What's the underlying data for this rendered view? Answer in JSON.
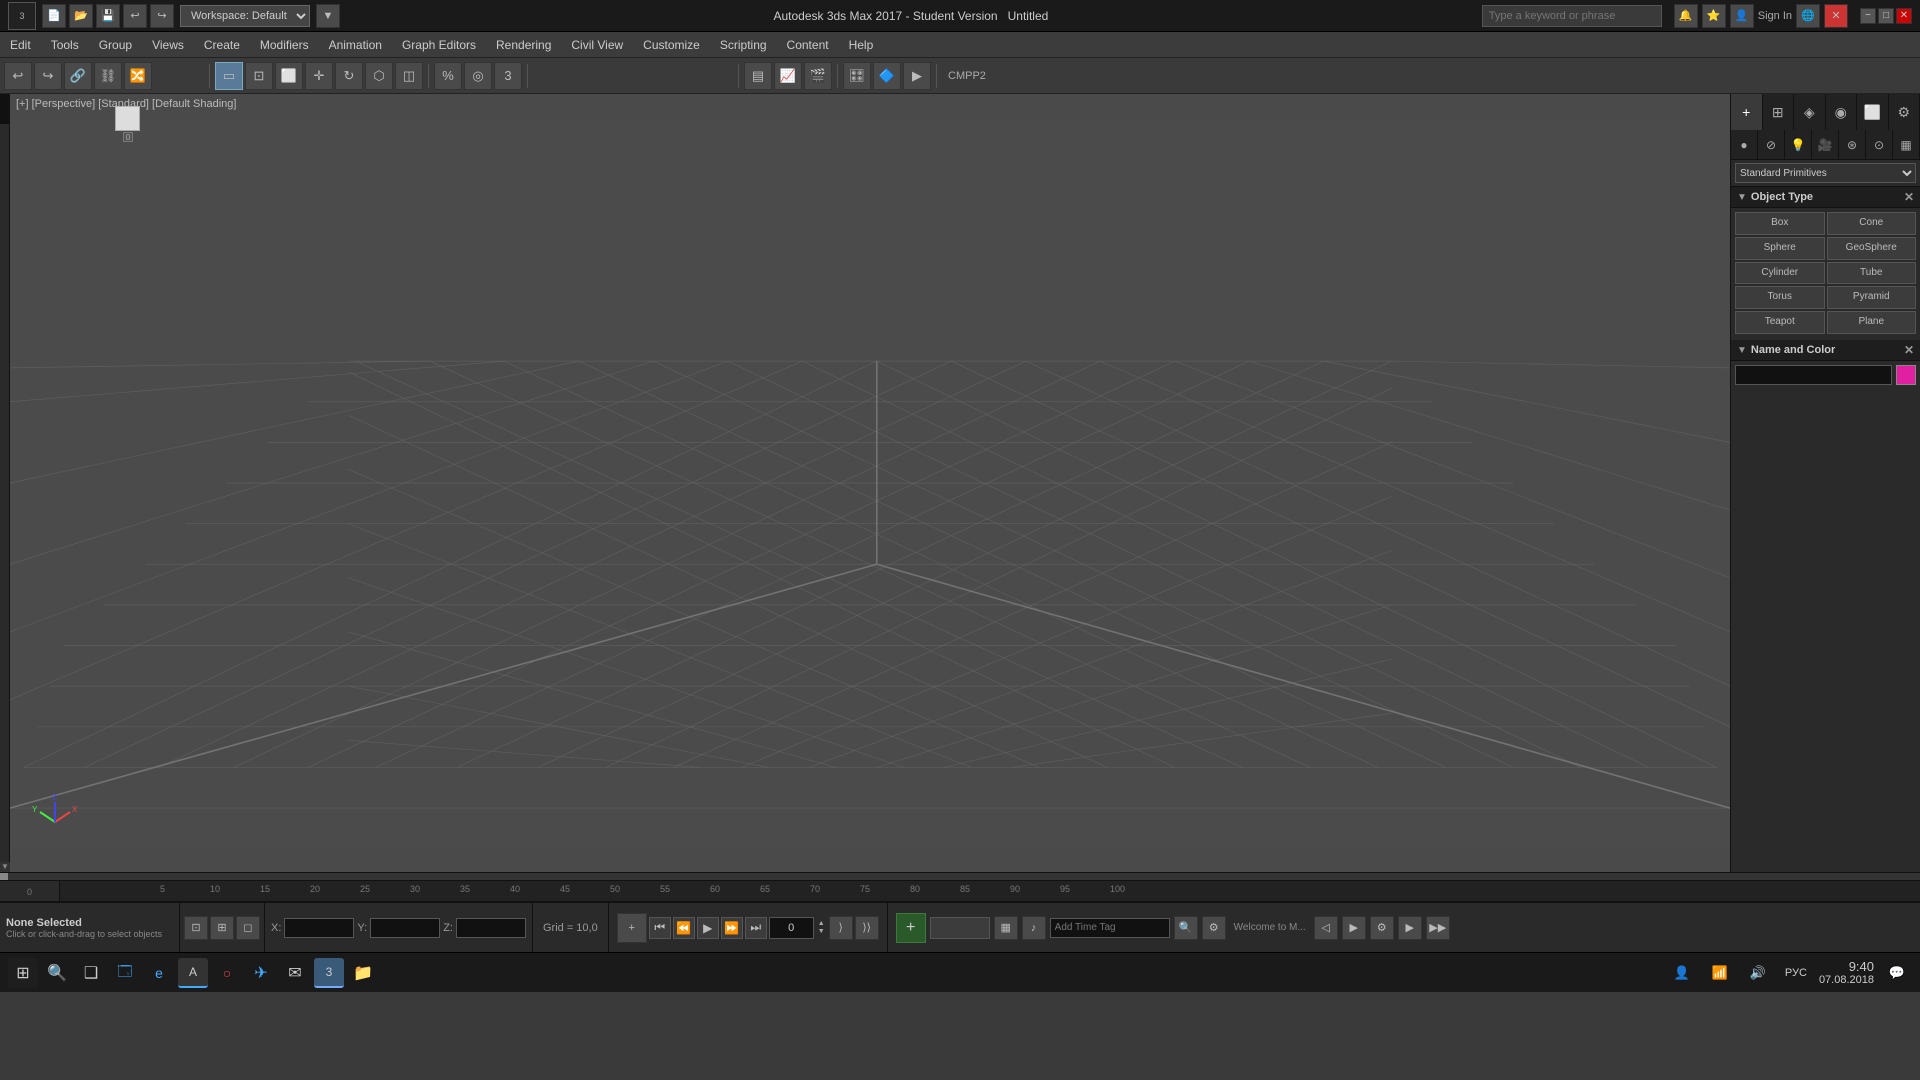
{
  "titlebar": {
    "app_name": "3",
    "title": "Autodesk 3ds Max 2017 - Student Version",
    "subtitle": "Untitled",
    "workspace_label": "Workspace: Default",
    "search_placeholder": "Type a keyword or phrase",
    "sign_in": "Sign In",
    "min_label": "−",
    "max_label": "□",
    "close_label": "✕"
  },
  "menu": {
    "items": [
      {
        "label": "Edit"
      },
      {
        "label": "Tools"
      },
      {
        "label": "Group"
      },
      {
        "label": "Views"
      },
      {
        "label": "Create"
      },
      {
        "label": "Modifiers"
      },
      {
        "label": "Animation"
      },
      {
        "label": "Graph Editors"
      },
      {
        "label": "Rendering"
      },
      {
        "label": "Civil View"
      },
      {
        "label": "Customize"
      },
      {
        "label": "Scripting"
      },
      {
        "label": "Content"
      },
      {
        "label": "Help"
      }
    ]
  },
  "viewport": {
    "label": "[+] [Perspective] [Standard] [Default Shading]",
    "background_color": "#4a4a4a"
  },
  "right_panel": {
    "tabs": [
      {
        "icon": "+",
        "label": "create"
      },
      {
        "icon": "⊞",
        "label": "modify"
      },
      {
        "icon": "◈",
        "label": "hierarchy"
      },
      {
        "icon": "◉",
        "label": "motion"
      },
      {
        "icon": "⬜",
        "label": "display"
      },
      {
        "icon": "⚙",
        "label": "utilities"
      }
    ],
    "tabs2": [
      {
        "icon": "○",
        "label": "geometry"
      },
      {
        "icon": "⊘",
        "label": "shapes"
      },
      {
        "icon": "💡",
        "label": "lights"
      },
      {
        "icon": "📷",
        "label": "cameras"
      },
      {
        "icon": "⊛",
        "label": "helpers"
      },
      {
        "icon": "⊙",
        "label": "spacewarps"
      },
      {
        "icon": "▦",
        "label": "systems"
      }
    ],
    "object_type": {
      "title": "Object Type",
      "buttons": [
        "Box",
        "Cone",
        "Sphere",
        "GeoSphere",
        "Cylinder",
        "Tube",
        "Torus",
        "Pyramid",
        "Teapot",
        "Plane"
      ]
    },
    "name_and_color": {
      "title": "Name and Color",
      "color": "#e020a0"
    }
  },
  "status_bar": {
    "selected": "None Selected",
    "hint": "Click or click-and-drag to select objects",
    "x_label": "X:",
    "y_label": "Y:",
    "z_label": "Z:",
    "x_value": "",
    "y_value": "",
    "z_value": "",
    "grid_label": "Grid = 10,0",
    "add_time_tag": "Add Time Tag",
    "welcome": "Welcome to M..."
  },
  "timeline": {
    "marks": [
      "5",
      "10",
      "15",
      "20",
      "25",
      "30",
      "35",
      "40",
      "45",
      "50",
      "55",
      "60",
      "65",
      "70",
      "75",
      "80",
      "85",
      "90",
      "95",
      "100"
    ]
  },
  "playback": {
    "go_start": "⏮",
    "prev_frame": "⏪",
    "play": "▶",
    "next_frame": "⏩",
    "go_end": "⏭"
  },
  "taskbar": {
    "start_icon": "⊞",
    "search_icon": "🔍",
    "task_view": "❑",
    "apps": [
      {
        "icon": "🗔",
        "label": "windows"
      },
      {
        "icon": "🔍",
        "label": "search"
      },
      {
        "icon": "❑",
        "label": "task-view"
      },
      {
        "icon": "e",
        "label": "edge"
      },
      {
        "icon": "A",
        "label": "illustrator"
      },
      {
        "icon": "○",
        "label": "opera"
      },
      {
        "icon": "✈",
        "label": "telegram"
      },
      {
        "icon": "✉",
        "label": "mail"
      },
      {
        "icon": "3",
        "label": "3dsmax"
      }
    ],
    "clock_time": "9:40",
    "clock_date": "07.08.2018",
    "lang": "РУС"
  },
  "colors": {
    "bg_dark": "#1a1a1a",
    "bg_medium": "#2a2a2a",
    "bg_light": "#3a3a3a",
    "border": "#111111",
    "accent_blue": "#3a5a7a",
    "accent_pink": "#e020a0",
    "text_light": "#cccccc",
    "text_dim": "#888888"
  }
}
